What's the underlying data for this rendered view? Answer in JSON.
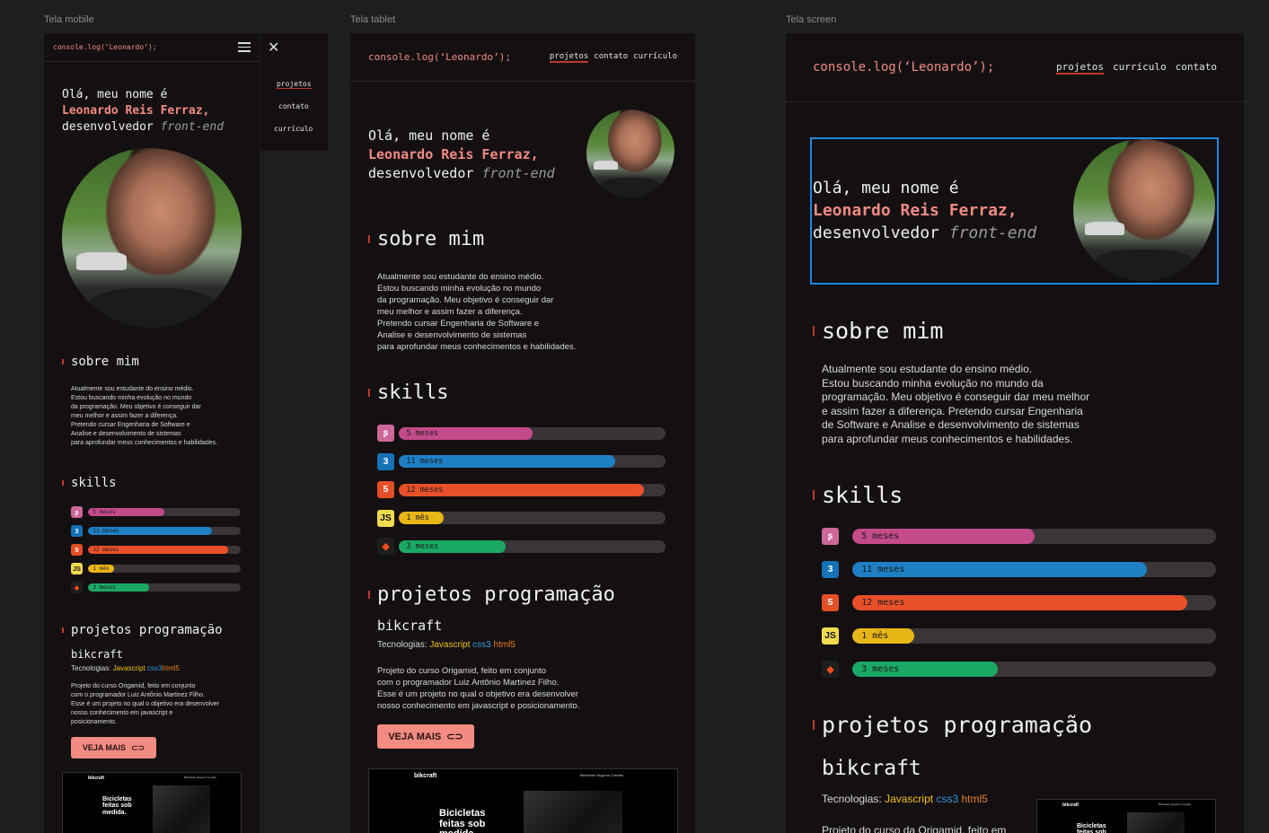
{
  "labels": {
    "mobile": "Tela mobile",
    "tablet": "Tela tablet",
    "screen": "Tela screen"
  },
  "colors": {
    "accent": "#f28b82",
    "bg": "#141011",
    "track": "#3a3536",
    "selection": "#1e88e5"
  },
  "brand": "console.log(‘Leonardo’);",
  "nav_mobile_menu": [
    "projetos",
    "contato",
    "currículo"
  ],
  "nav_tablet": [
    "projetos",
    "contato",
    "currículo"
  ],
  "nav_screen": [
    "projetos",
    "currículo",
    "contato"
  ],
  "icons": {
    "menu": "hamburger-icon",
    "close": "close-icon",
    "link": "link-icon"
  },
  "hero": {
    "line1": "Olá, meu nome é",
    "name": "Leonardo Reis Ferraz,",
    "role_prefix": "desenvolvedor",
    "role": "front-end"
  },
  "about": {
    "title": "sobre mim",
    "mobile_lines": [
      "Atualmente sou estudante do ensino médio.",
      "Estou buscando minha evolução no mundo",
      "da programação. Meu objetivo é conseguir dar",
      "meu melhor e assim fazer a diferença.",
      "Pretendo cursar Engenharia de Software e",
      "Analise e desenvolvimento de sistemas",
      "para aprofundar meus conhecimentos e habilidades."
    ],
    "tablet_lines": [
      "Atualmente sou estudante do ensino médio.",
      "Estou buscando minha evolução no mundo",
      "da programação. Meu objetivo é conseguir dar",
      "meu melhor e assim fazer a diferença.",
      "Pretendo cursar Engenharia de Software e",
      "Analise e desenvolvimento de sistemas",
      "para aprofundar meus conhecimentos e habilidades."
    ],
    "screen_lines": [
      "Atualmente sou estudante do ensino médio.",
      "Estou buscando minha evolução no mundo da",
      "programação. Meu objetivo é conseguir dar meu melhor",
      "e assim fazer a diferença. Pretendo cursar Engenharia",
      "de Software e Analise e desenvolvimento de sistemas",
      "para aprofundar meus conhecimentos e habilidades."
    ]
  },
  "skills": {
    "title": "skills",
    "items": [
      {
        "icon": "sass-icon",
        "glyph": "ʂ",
        "label": "5 meses",
        "fraction": 0.5,
        "color": "#c44b8a",
        "icon_bg": "#cd6799"
      },
      {
        "icon": "css3-icon",
        "glyph": "3",
        "label": "11 meses",
        "fraction": 0.81,
        "color": "#1e7fc4",
        "icon_bg": "#1572b6"
      },
      {
        "icon": "html5-icon",
        "glyph": "5",
        "label": "12 meses",
        "fraction": 0.92,
        "color": "#e8502a",
        "icon_bg": "#e34f26"
      },
      {
        "icon": "javascript-icon",
        "glyph": "JS",
        "label": "1 mês",
        "fraction": 0.17,
        "color": "#e9b617",
        "icon_bg": "#f0db4f"
      },
      {
        "icon": "figma-icon",
        "glyph": "◆",
        "label": "3 meses",
        "fraction": 0.4,
        "color": "#1aa864",
        "icon_bg": "#1e1e1e"
      }
    ]
  },
  "projects": {
    "title": "projetos programação",
    "name": "bikcraft",
    "tech_label": "Tecnologias:",
    "tech": {
      "js": "Javascript",
      "css": "css3",
      "html": "html5"
    },
    "desc_mobile": [
      "Projeto do curso  Origamid, feito em conjunto",
      "com o programador Luiz Antônio Martinez Filho.",
      "Esse é um projeto no qual o objetivo era desenvolver",
      "nosso conhecimento em javascript e",
      "posicionamento."
    ],
    "desc_tablet": [
      "Projeto do curso  Origamid, feito em conjunto",
      "com o programador Luiz Antônio Martinez Filho.",
      "Esse é um projeto no qual o objetivo era desenvolver",
      "nosso conhecimento em javascript e posicionamento."
    ],
    "desc_screen": [
      "Projeto do curso da Origamid, feito em"
    ],
    "button": "VEJA MAIS",
    "preview": {
      "logo": "bikcraft",
      "nav": "Bicicletas   Seguros   Contato",
      "headline": "Bicicletas feitas sob medida."
    }
  }
}
